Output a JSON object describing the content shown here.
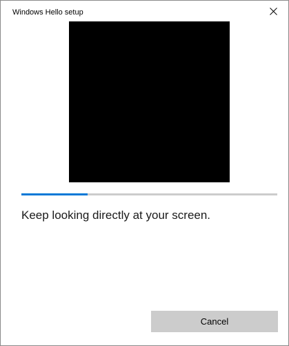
{
  "window": {
    "title": "Windows Hello setup",
    "close_icon": "close-icon"
  },
  "camera": {
    "background_color": "#000000"
  },
  "progress": {
    "value": 0.26,
    "accent_color": "#0078d7",
    "track_color": "#cccccc"
  },
  "main": {
    "instruction": "Keep looking directly at your screen."
  },
  "footer": {
    "cancel_label": "Cancel"
  }
}
